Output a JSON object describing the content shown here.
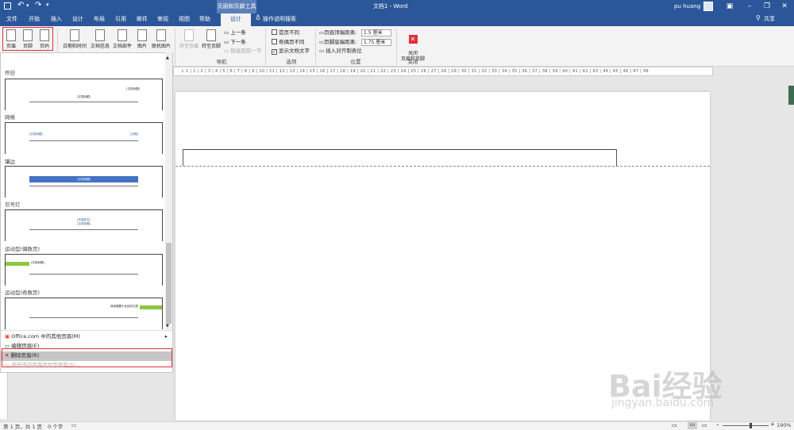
{
  "titlebar": {
    "context_header": "页眉和页脚工具",
    "title": "文档1 - Word",
    "user": "pu huang",
    "save_icon": "save-icon",
    "undo_icon": "undo-icon",
    "redo_icon": "redo-icon"
  },
  "tabs": [
    {
      "label": "文件"
    },
    {
      "label": "开始"
    },
    {
      "label": "插入"
    },
    {
      "label": "设计"
    },
    {
      "label": "布局"
    },
    {
      "label": "引用"
    },
    {
      "label": "邮件"
    },
    {
      "label": "审阅"
    },
    {
      "label": "视图"
    },
    {
      "label": "帮助"
    }
  ],
  "active_tab": "设计",
  "tell_me": "操作说明搜索",
  "share": "共享",
  "ribbon": {
    "header": "页眉",
    "footer": "页脚",
    "pagenum": "页码",
    "datetime": "日期和时间",
    "docinfo": "文档信息",
    "quickparts": "文档部件",
    "pictures": "图片",
    "online_pictures": "联机图片",
    "goto_header": "转至页眉",
    "goto_footer": "转至页脚",
    "prev": "上一条",
    "next": "下一条",
    "link_prev": "链接到前一节",
    "nav_group": "导航",
    "diff_first": "首页不同",
    "diff_oddeven": "奇偶页不同",
    "show_text": "显示文档文字",
    "options_group": "选项",
    "header_top": "页眉顶端距离:",
    "header_top_val": "1.5 厘米",
    "footer_bottom": "页脚底端距离:",
    "footer_bottom_val": "1.75 厘米",
    "insert_align": "插入对齐制表位",
    "position_group": "位置",
    "close": "关闭\n页眉和页脚",
    "close_group": "关闭"
  },
  "ruler_text": "L 1 | 1 | 2 | 3 | 4 | 5 | 6 | 7 | 8 | 9 | 10 | 11 | 12 | 13 | 14 | 15 | 16 | 17 | 18 | 19 | 20 | 21 | 22 | 23 | 24 | 25 | 26 | 27 | 28 | 29 | 30 | 31 | 32 | 33 | 34 | 35 | 36 | 37 | 38 | 39 | 40 | 41 | 42 | 43 | 44 | 45 | 46 | 47 | 48",
  "gallery": {
    "items": [
      {
        "name": "怀旧",
        "text_right": "[文档标题]",
        "text_center": "[文档标题]"
      },
      {
        "name": "网格",
        "text_left": "[文档标题]",
        "text_right": "[日期]"
      },
      {
        "name": "镶边",
        "text_center": "[文档标题]"
      },
      {
        "name": "信号灯",
        "text_center": "[作者姓名]",
        "text_center2": "[文档标题]"
      },
      {
        "name": "运动型(偶数页)",
        "text_left": "[文档标题]"
      },
      {
        "name": "运动型(奇数页)",
        "text_right": "将标题置于此处的文档"
      }
    ],
    "menu": [
      {
        "label": "Office.com 中的其他页眉(M)",
        "disabled": false
      },
      {
        "label": "编辑页眉(E)",
        "disabled": false
      },
      {
        "label": "删除页眉(R)",
        "disabled": false
      },
      {
        "label": "将所选内容保存到页眉库(S)...",
        "disabled": true
      }
    ]
  },
  "statusbar": {
    "page": "第 1 页，共 1 页",
    "words": "0 个字",
    "zoom": "190%"
  },
  "watermark": {
    "main": "Bai经验",
    "sub": "jingyan.baidu.com"
  },
  "colors": {
    "word_blue": "#2b579a",
    "highlight_red": "#e0303a",
    "close_red": "#e0303a"
  }
}
